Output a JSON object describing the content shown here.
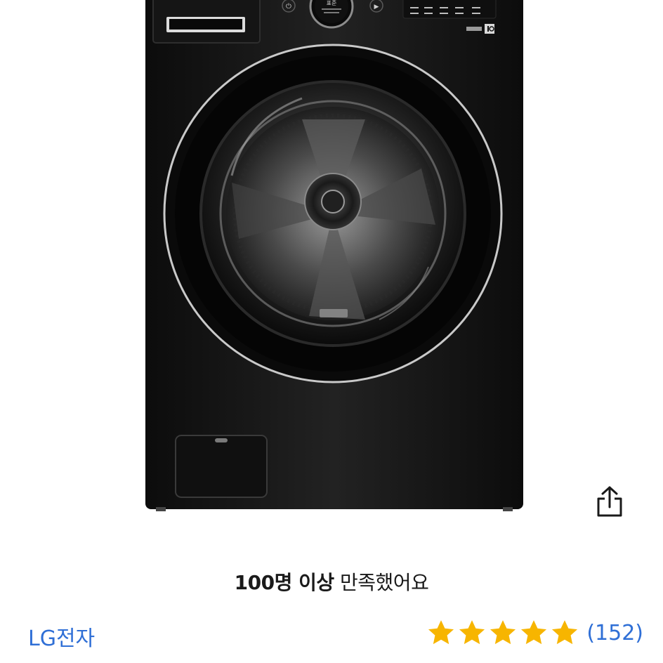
{
  "product": {
    "image_icon": "washing-machine-image",
    "panel_label": "표준"
  },
  "share": {
    "icon": "share-icon"
  },
  "headline": {
    "strong": "100명 이상",
    "normal": "만족했어요"
  },
  "seller": {
    "brand": "LG전자"
  },
  "rating": {
    "stars": 5,
    "count_text": "(152)",
    "star_color": "#f7b500",
    "link_color": "#2f6fd6"
  }
}
